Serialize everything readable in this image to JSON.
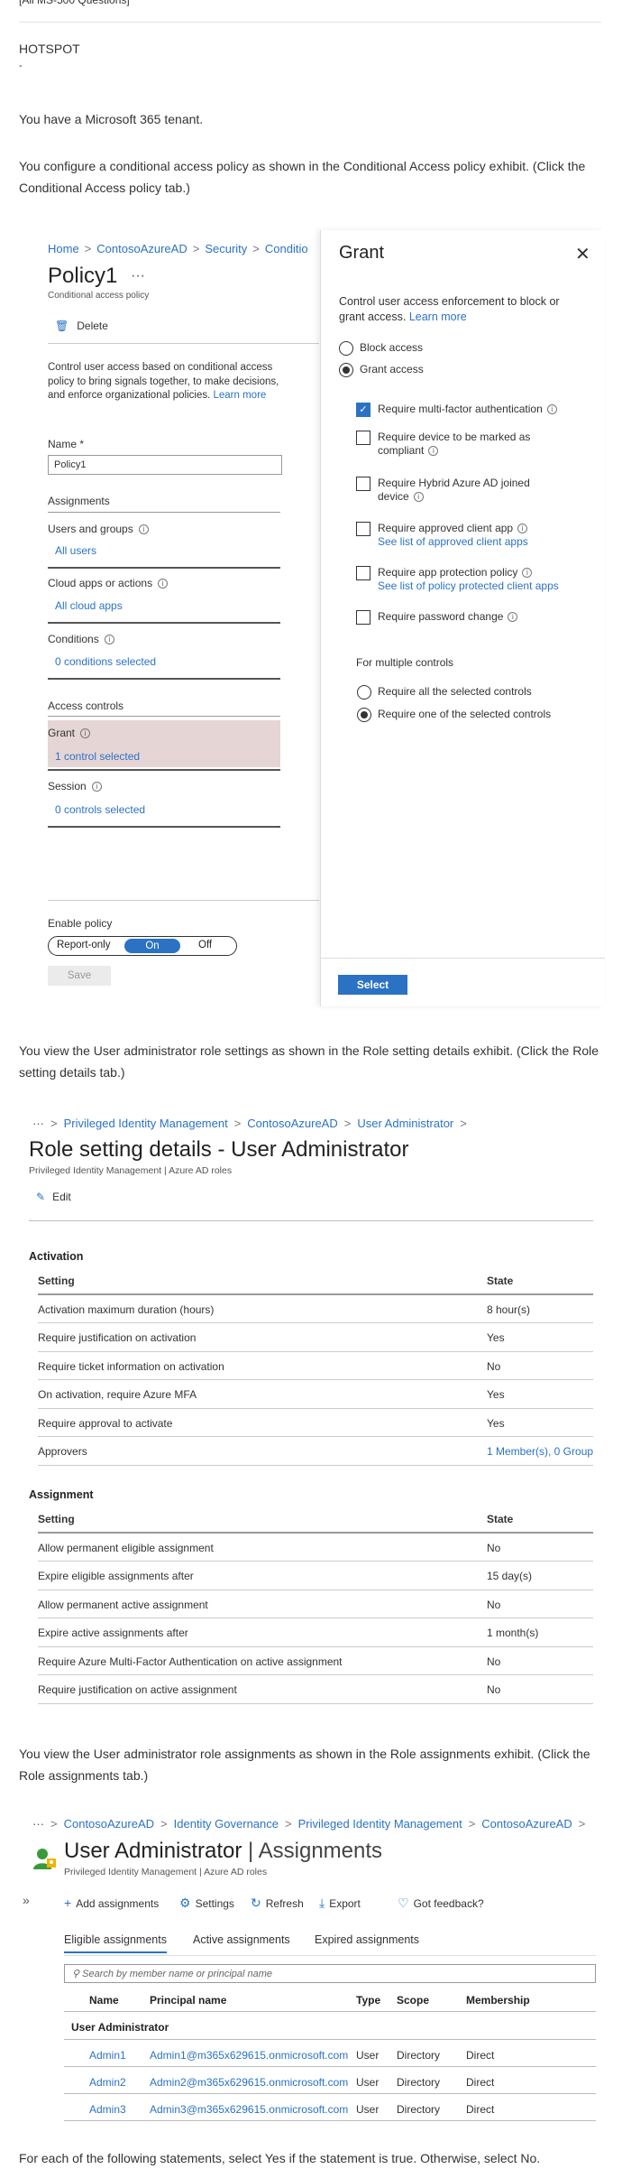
{
  "question": {
    "top_link": "[All MS-500 Questions]",
    "type": "HOTSPOT",
    "dash": "-",
    "intro": "You have a Microsoft 365 tenant.",
    "ca_text": "You configure a conditional access policy as shown in the Conditional Access policy exhibit. (Click the Conditional Access policy tab.)",
    "rs_text": "You view the User administrator role settings as shown in the Role setting details exhibit. (Click the Role setting details tab.)",
    "ra_text": "You view the User administrator role assignments as shown in the Role assignments exhibit. (Click the Role assignments tab.)",
    "final_text": "For each of the following statements, select Yes if the statement is true. Otherwise, select No."
  },
  "ca": {
    "breadcrumb": [
      "Home",
      "ContosoAzureAD",
      "Security",
      "Conditio"
    ],
    "title": "Policy1",
    "title_menu": "···",
    "subtitle": "Conditional access policy",
    "delete_label": "Delete",
    "description": "Control user access based on conditional access policy to bring signals together, to make decisions, and enforce organizational policies.",
    "learn_more": "Learn more",
    "name_label": "Name *",
    "name_value": "Policy1",
    "assignments_label": "Assignments",
    "users_label": "Users and groups",
    "users_value": "All users",
    "cloud_label": "Cloud apps or actions",
    "cloud_value": "All cloud apps",
    "conditions_label": "Conditions",
    "conditions_value": "0 conditions selected",
    "access_controls_label": "Access controls",
    "grant_label": "Grant",
    "grant_value": "1 control selected",
    "session_label": "Session",
    "session_value": "0 controls selected",
    "enable_label": "Enable policy",
    "toggle": [
      "Report-only",
      "On",
      "Off"
    ],
    "save_label": "Save"
  },
  "grant": {
    "title": "Grant",
    "close": "✕",
    "description": "Control user access enforcement to block or grant access.",
    "learn_more": "Learn more",
    "block": "Block access",
    "grant": "Grant access",
    "controls": [
      {
        "label": "Require multi-factor authentication",
        "checked": true,
        "sub": ""
      },
      {
        "label": "Require device to be marked as compliant",
        "checked": false,
        "sub": ""
      },
      {
        "label": "Require Hybrid Azure AD joined device",
        "checked": false,
        "sub": ""
      },
      {
        "label": "Require approved client app",
        "checked": false,
        "sub": "See list of approved client apps"
      },
      {
        "label": "Require app protection policy",
        "checked": false,
        "sub": "See list of policy protected client apps"
      },
      {
        "label": "Require password change",
        "checked": false,
        "sub": ""
      }
    ],
    "multiple_label": "For multiple controls",
    "require_all": "Require all the selected controls",
    "require_one": "Require one of the selected controls",
    "select_label": "Select"
  },
  "role_settings": {
    "breadcrumb": [
      "···",
      "Privileged Identity Management",
      "ContosoAzureAD",
      "User Administrator"
    ],
    "title": "Role setting details - User Administrator",
    "subtitle": "Privileged Identity Management | Azure AD roles",
    "edit_label": "Edit",
    "activation_label": "Activation",
    "assignment_label": "Assignment",
    "col_setting": "Setting",
    "col_state": "State",
    "activation": [
      [
        "Activation maximum duration (hours)",
        "8 hour(s)"
      ],
      [
        "Require justification on activation",
        "Yes"
      ],
      [
        "Require ticket information on activation",
        "No"
      ],
      [
        "On activation, require Azure MFA",
        "Yes"
      ],
      [
        "Require approval to activate",
        "Yes"
      ],
      [
        "Approvers",
        "1 Member(s), 0 Group"
      ]
    ],
    "assignment": [
      [
        "Allow permanent eligible assignment",
        "No"
      ],
      [
        "Expire eligible assignments after",
        "15 day(s)"
      ],
      [
        "Allow permanent active assignment",
        "No"
      ],
      [
        "Expire active assignments after",
        "1 month(s)"
      ],
      [
        "Require Azure Multi-Factor Authentication on active assignment",
        "No"
      ],
      [
        "Require justification on active assignment",
        "No"
      ]
    ]
  },
  "assignments": {
    "breadcrumb": [
      "···",
      "ContosoAzureAD",
      "Identity Governance",
      "Privileged Identity Management",
      "ContosoAzureAD"
    ],
    "title_main": "User Administrator",
    "title_sep": " | ",
    "title_rest": "Assignments",
    "subtitle": "Privileged Identity Management | Azure AD roles",
    "expand": "»",
    "toolbar": [
      "Add assignments",
      "Settings",
      "Refresh",
      "Export",
      "Got feedback?"
    ],
    "tabs": [
      "Eligible assignments",
      "Active assignments",
      "Expired assignments"
    ],
    "search_placeholder": "Search by member name or principal name",
    "columns": [
      "Name",
      "Principal name",
      "Type",
      "Scope",
      "Membership"
    ],
    "group": "User Administrator",
    "rows": [
      [
        "Admin1",
        "Admin1@m365x629615.onmicrosoft.com",
        "User",
        "Directory",
        "Direct"
      ],
      [
        "Admin2",
        "Admin2@m365x629615.onmicrosoft.com",
        "User",
        "Directory",
        "Direct"
      ],
      [
        "Admin3",
        "Admin3@m365x629615.onmicrosoft.com",
        "User",
        "Directory",
        "Direct"
      ]
    ]
  }
}
